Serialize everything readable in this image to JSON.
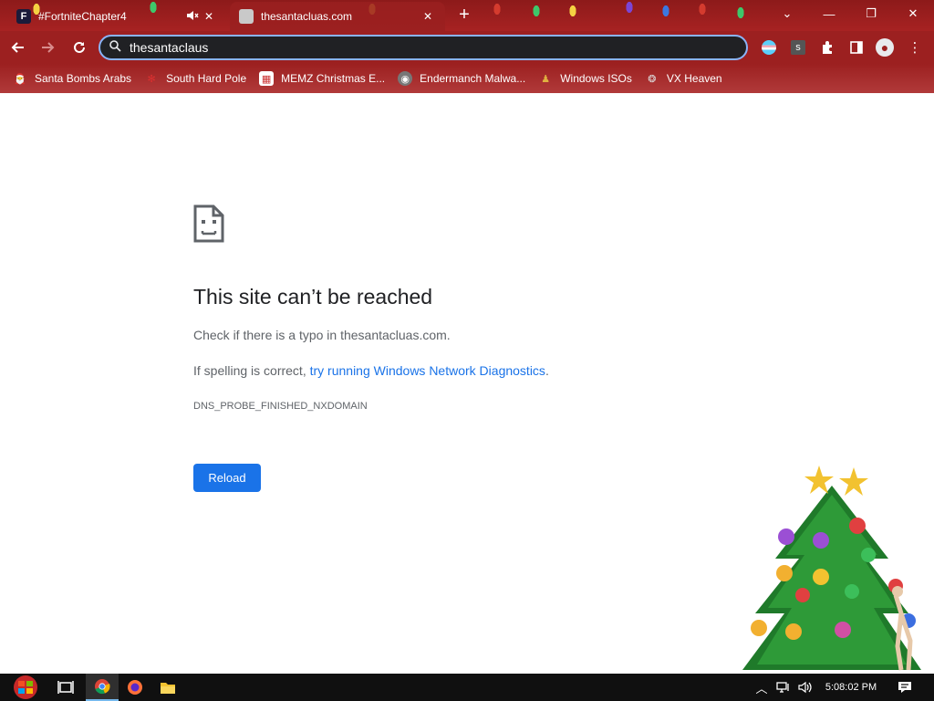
{
  "tabs": [
    {
      "title": "#FortniteChapter4",
      "active": false,
      "muted": true
    },
    {
      "title": "thesantacluas.com",
      "active": true
    }
  ],
  "new_tab_label": "+",
  "omnibox": {
    "value": "thesantaclaus",
    "placeholder": ""
  },
  "bookmarks": [
    {
      "label": "Santa Bombs Arabs",
      "icon": "santa-icon"
    },
    {
      "label": "South Hard Pole",
      "icon": "snowflake-icon"
    },
    {
      "label": "MEMZ Christmas E...",
      "icon": "memz-icon"
    },
    {
      "label": "Endermanch Malwa...",
      "icon": "raccoon-icon"
    },
    {
      "label": "Windows ISOs",
      "icon": "figure-icon"
    },
    {
      "label": "VX Heaven",
      "icon": "vx-icon"
    }
  ],
  "error": {
    "title": "This site can’t be reached",
    "line1": "Check if there is a typo in thesantacluas.com.",
    "line2_prefix": "If spelling is correct, ",
    "line2_link": "try running Windows Network Diagnostics",
    "line2_suffix": ".",
    "code": "DNS_PROBE_FINISHED_NXDOMAIN",
    "reload_label": "Reload"
  },
  "taskbar": {
    "clock": "5:08:02 PM",
    "apps": [
      "task-view-icon",
      "chrome-icon",
      "firefox-icon",
      "file-explorer-icon"
    ]
  },
  "colors": {
    "chrome_frame": "#9c2020",
    "omnibox_bg": "#202124",
    "omnibox_focus": "#8ab4f8",
    "link_blue": "#1a73e8",
    "button_blue": "#1a73e8",
    "taskbar": "#101010"
  }
}
